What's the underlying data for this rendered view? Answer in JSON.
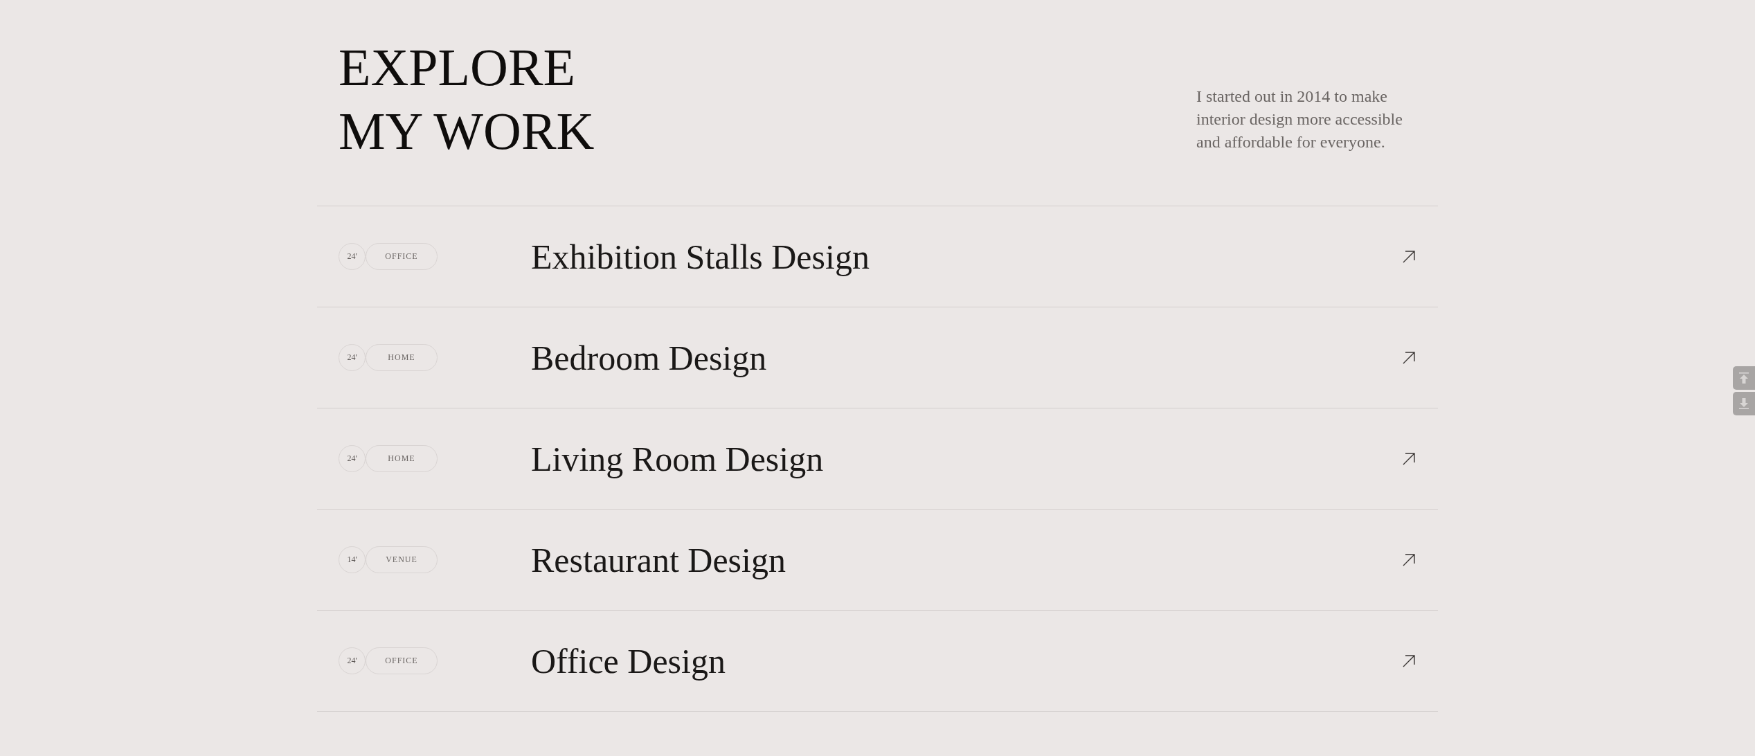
{
  "header": {
    "heading": "EXPLORE MY WORK",
    "intro": "I started out in 2014 to make interior design more accessible and affordable for everyone."
  },
  "projects": [
    {
      "year": "24'",
      "category": "OFFICE",
      "title": "Exhibition Stalls Design"
    },
    {
      "year": "24'",
      "category": "HOME",
      "title": "Bedroom Design"
    },
    {
      "year": "24'",
      "category": "HOME",
      "title": "Living Room Design"
    },
    {
      "year": "14'",
      "category": "VENUE",
      "title": "Restaurant Design"
    },
    {
      "year": "24'",
      "category": "OFFICE",
      "title": "Office Design"
    }
  ]
}
